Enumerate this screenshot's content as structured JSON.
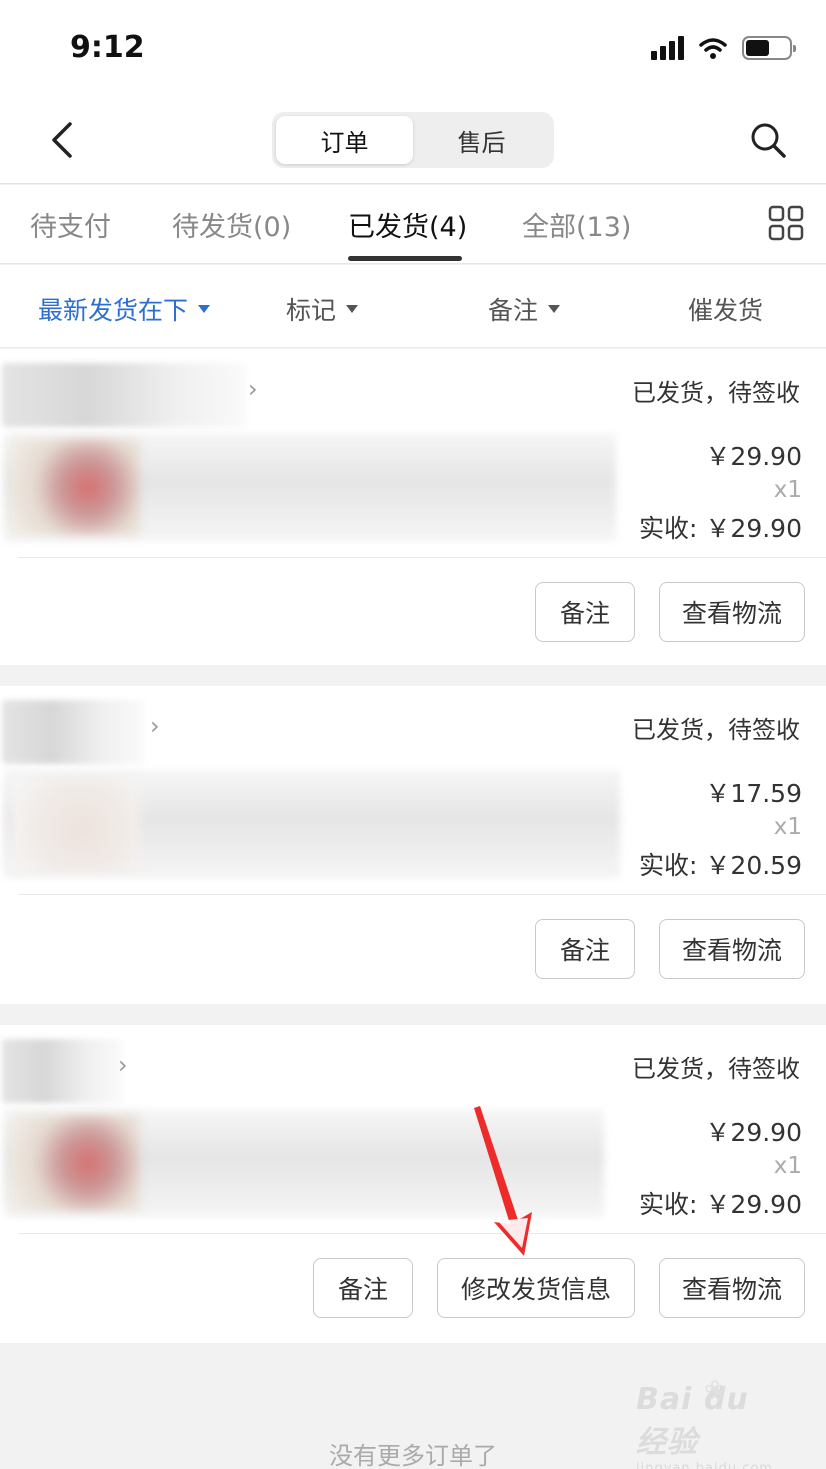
{
  "status_bar": {
    "time": "9:12",
    "icons": [
      "signal-icon",
      "wifi-icon",
      "battery-icon"
    ]
  },
  "nav": {
    "segments": [
      {
        "label": "订单",
        "active": true
      },
      {
        "label": "售后",
        "active": false
      }
    ],
    "back_icon": "chevron-left-icon",
    "search_icon": "search-icon"
  },
  "tabs": [
    {
      "label": "待支付"
    },
    {
      "label": "待发货",
      "count": "(0)"
    },
    {
      "label": "已发货",
      "count": "(4)",
      "active": true
    },
    {
      "label": "全部",
      "count": "(13)"
    }
  ],
  "filters": {
    "sort": "最新发货在下",
    "mark": "标记",
    "remark": "备注",
    "urge": "催发货"
  },
  "orders": [
    {
      "status": "已发货，待签收",
      "price": "￥29.90",
      "qty": "x1",
      "paid": "实收: ￥29.90",
      "buttons": [
        "备注",
        "查看物流"
      ]
    },
    {
      "status": "已发货，待签收",
      "price": "￥17.59",
      "qty": "x1",
      "paid": "实收: ￥20.59",
      "buttons": [
        "备注",
        "查看物流"
      ]
    },
    {
      "status": "已发货，待签收",
      "price": "￥29.90",
      "qty": "x1",
      "paid": "实收: ￥29.90",
      "buttons": [
        "备注",
        "修改发货信息",
        "查看物流"
      ]
    }
  ],
  "footer": {
    "no_more": "没有更多订单了"
  },
  "watermark": {
    "logo": "Bai du 经验",
    "sub": "jingyan.baidu.com"
  },
  "colors": {
    "accent": "#2d6fd0",
    "annotation_arrow": "#ee2b2b"
  }
}
